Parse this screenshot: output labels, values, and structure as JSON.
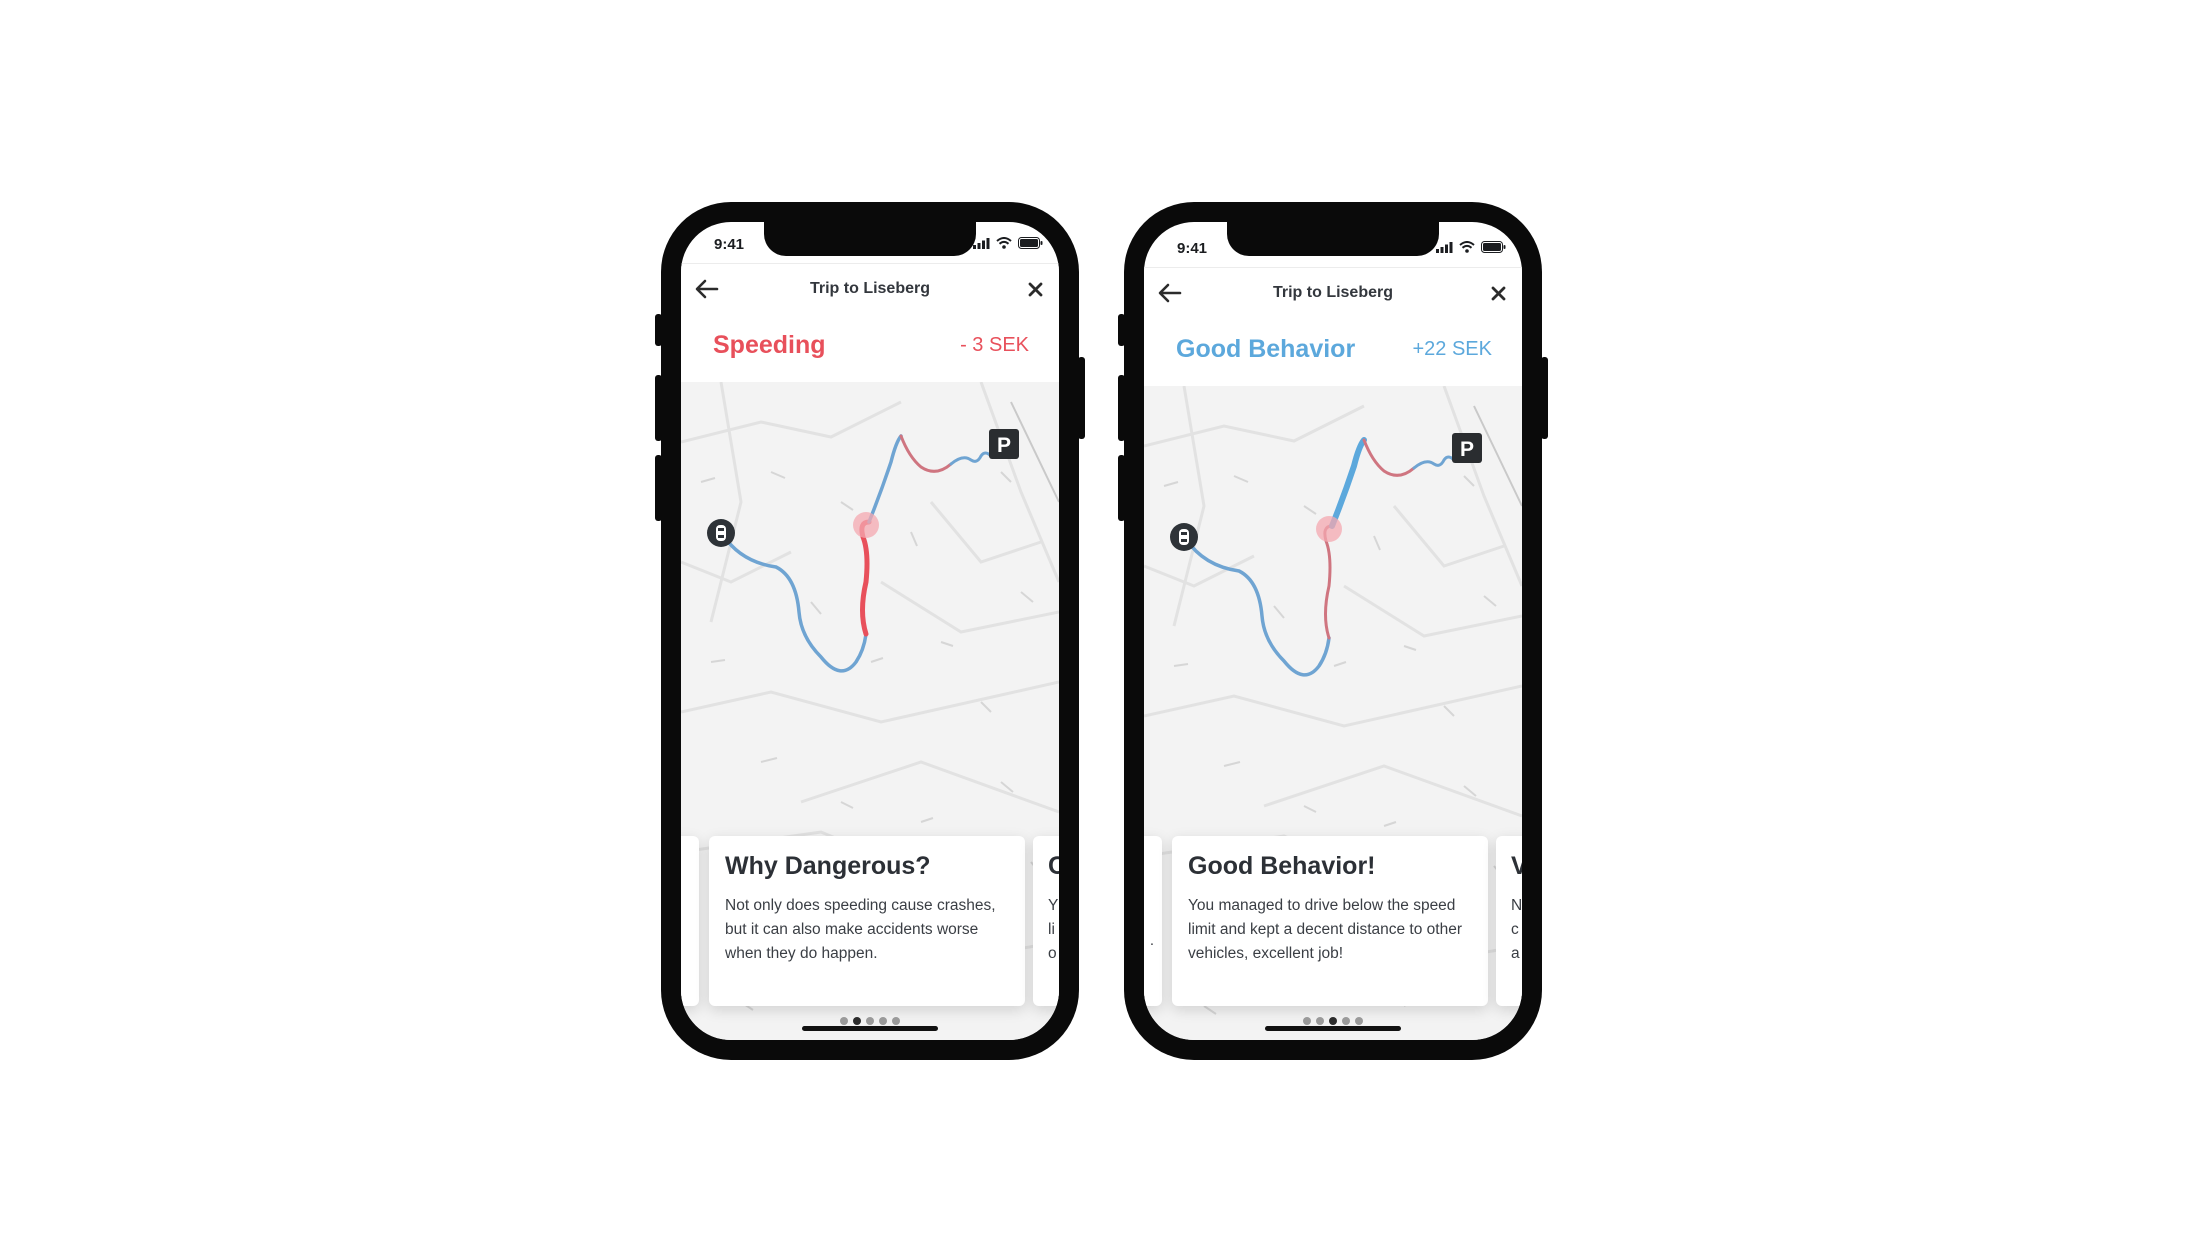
{
  "phones": [
    {
      "status_time": "9:41",
      "nav_title": "Trip to Liseberg",
      "event_title": "Speeding",
      "event_amount": "- 3 SEK",
      "event_color": "#e8505b",
      "card_title": "Why Dangerous?",
      "card_body": "Not only does speeding cause crashes, but it can also make accidents worse when they do happen.",
      "next_card_title_partial": "C",
      "next_card_body_partial": "Y\nli\no",
      "pager_total": 5,
      "pager_active": 2
    },
    {
      "status_time": "9:41",
      "nav_title": "Trip to Liseberg",
      "event_title": "Good Behavior",
      "event_amount": "+22 SEK",
      "event_color": "#5ca8dc",
      "card_title": "Good Behavior!",
      "card_body": "You managed to drive below the speed limit and kept a decent distance to other vehicles, excellent job!",
      "next_card_title_partial": "V",
      "next_card_body_partial": "N\nc\na",
      "prev_card_partial": ".",
      "pager_total": 5,
      "pager_active": 3
    }
  ],
  "icons": {
    "back": "arrow-left-icon",
    "close": "close-icon",
    "parking": "parking-icon",
    "car": "car-icon",
    "signal": "signal-icon",
    "wifi": "wifi-icon",
    "battery": "battery-icon"
  },
  "map_labels": {
    "parking": "P"
  },
  "colors": {
    "route_blue": "#6fa4d2",
    "route_red": "#e8505b",
    "route_muted_red": "#cf7580",
    "map_bg": "#f3f3f3"
  }
}
